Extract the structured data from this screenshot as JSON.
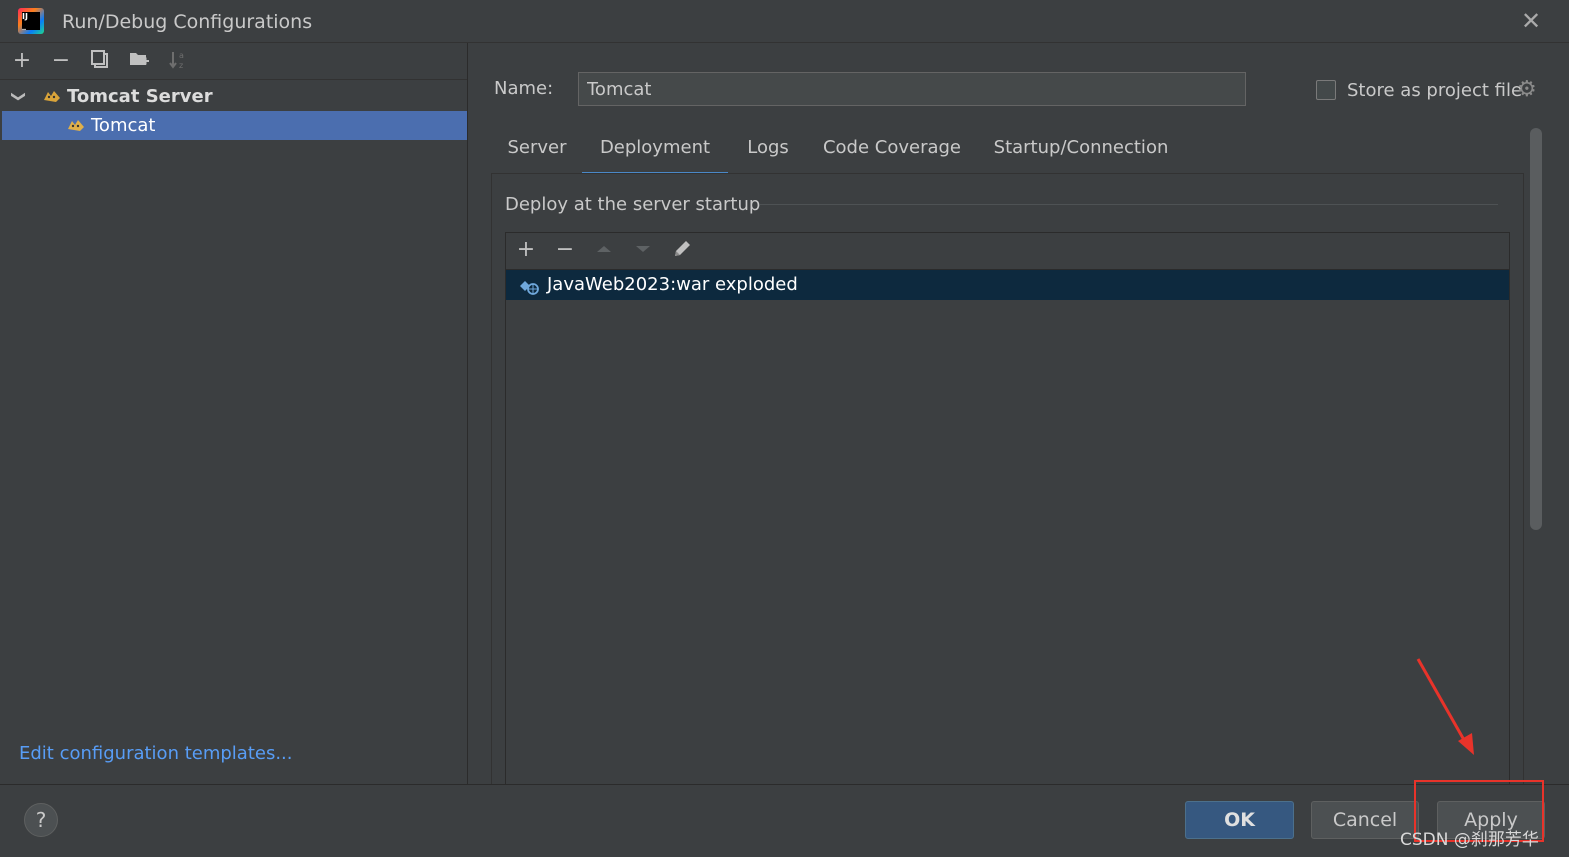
{
  "window": {
    "title": "Run/Debug Configurations",
    "close": "✕"
  },
  "left_toolbar": {
    "add": "+",
    "remove": "−"
  },
  "tree": {
    "group_label": "Tomcat Server",
    "item_label": "Tomcat"
  },
  "left_footer": {
    "edit_templates": "Edit configuration templates..."
  },
  "config": {
    "name_label": "Name:",
    "name_value": "Tomcat",
    "store_label": "Store as project file",
    "store_checked": false
  },
  "tabs": [
    {
      "label": "Server",
      "active": false
    },
    {
      "label": "Deployment",
      "active": true
    },
    {
      "label": "Logs",
      "active": false
    },
    {
      "label": "Code Coverage",
      "active": false
    },
    {
      "label": "Startup/Connection",
      "active": false
    }
  ],
  "deployment": {
    "section_title": "Deploy at the server startup",
    "toolbar": {
      "add": "+",
      "remove": "−"
    },
    "artifacts": [
      "JavaWeb2023:war exploded"
    ]
  },
  "buttons": {
    "help": "?",
    "ok": "OK",
    "cancel": "Cancel",
    "apply": "Apply"
  },
  "watermark": "CSDN @刹那芳华",
  "colors": {
    "background": "#3c3f41",
    "selection": "#4b6eaf",
    "list_selection": "#0d293e",
    "link": "#589df6",
    "tab_underline": "#4a88c7",
    "ok_button": "#365880",
    "annotation_red": "#e8332a"
  }
}
